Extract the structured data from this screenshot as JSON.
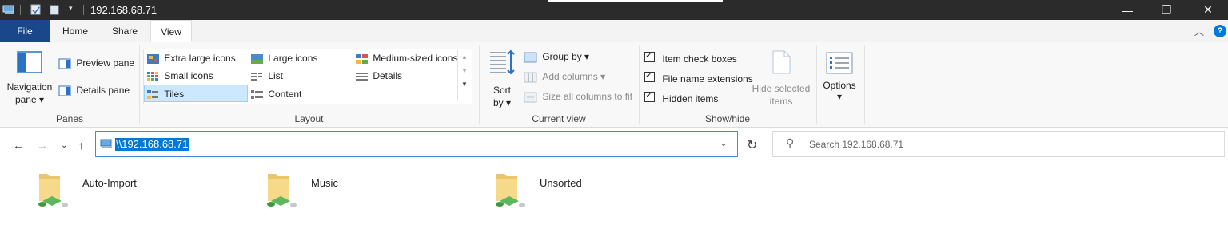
{
  "window": {
    "title": "192.168.68.71",
    "controls": {
      "minimize": "—",
      "maximize": "❐",
      "close": "✕"
    }
  },
  "tabs": [
    {
      "label": "File"
    },
    {
      "label": "Home"
    },
    {
      "label": "Share"
    },
    {
      "label": "View",
      "active": true
    }
  ],
  "ribbon": {
    "panes": {
      "navigation_pane": "Navigation",
      "navigation_pane2": "pane",
      "preview_pane": "Preview pane",
      "details_pane": "Details pane",
      "label": "Panes"
    },
    "layout": {
      "label": "Layout",
      "items": [
        "Extra large icons",
        "Large icons",
        "Medium-sized icons",
        "Small icons",
        "List",
        "Details",
        "Tiles",
        "Content"
      ],
      "selected": "Tiles"
    },
    "current_view": {
      "label": "Current view",
      "sort": "Sort",
      "sort2": "by",
      "group_by": "Group by",
      "add_columns": "Add columns",
      "size_columns": "Size all columns to fit"
    },
    "show_hide": {
      "label": "Show/hide",
      "item_check_boxes": "Item check boxes",
      "file_name_extensions": "File name extensions",
      "hidden_items": "Hidden items",
      "hide_selected": "Hide selected",
      "hide_selected2": "items"
    },
    "options": {
      "label": "Options"
    }
  },
  "address": {
    "path": "\\\\192.168.68.71",
    "search_placeholder": "Search 192.168.68.71"
  },
  "folders": [
    {
      "name": "Auto-Import"
    },
    {
      "name": "Music"
    },
    {
      "name": "Unsorted"
    }
  ],
  "colors": {
    "accent": "#0078d7",
    "file_tab": "#19478a",
    "selection": "#cce8ff"
  }
}
